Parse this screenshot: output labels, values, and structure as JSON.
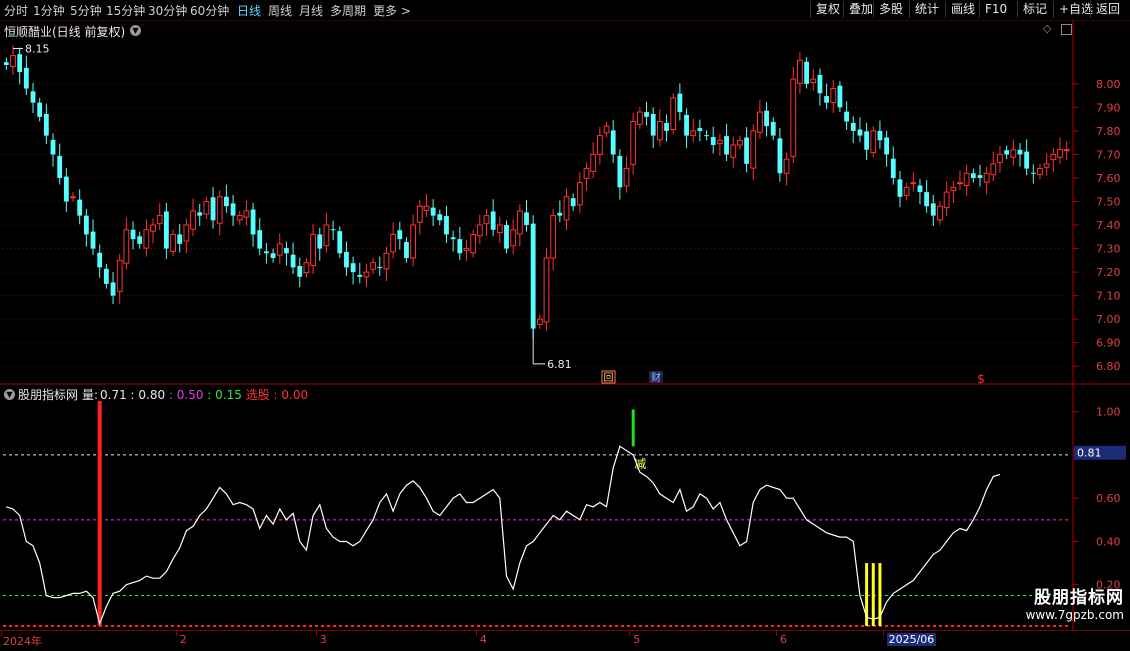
{
  "toolbar": {
    "left": [
      {
        "label": "分时",
        "active": false
      },
      {
        "label": "1分钟",
        "active": false
      },
      {
        "label": "5分钟",
        "active": false
      },
      {
        "label": "15分钟",
        "active": false
      },
      {
        "label": "30分钟",
        "active": false
      },
      {
        "label": "60分钟",
        "active": false
      },
      {
        "label": "日线",
        "active": true
      },
      {
        "label": "周线",
        "active": false
      },
      {
        "label": "月线",
        "active": false
      },
      {
        "label": "多周期",
        "active": false
      },
      {
        "label": "更多 >",
        "active": false
      }
    ],
    "right": [
      "复权",
      "叠加",
      "多股",
      "统计",
      "画线",
      "F10",
      "标记",
      "+自选",
      "返回"
    ]
  },
  "price_panel": {
    "title": "恒顺醋业(日线 前复权)",
    "high_label": "8.15",
    "low_label": "6.81",
    "markers": {
      "hui": "回",
      "cai": "财",
      "s": "$"
    }
  },
  "indicator_panel": {
    "name": "股朋指标网",
    "line_label": "量:",
    "values": [
      {
        "text": "0.71",
        "color": "#e8e8e8"
      },
      {
        "text": ": 0.80",
        "color": "#e8e8e8"
      },
      {
        "text": ": 0.50",
        "color": "#e040e0"
      },
      {
        "text": ": 0.15",
        "color": "#40e040"
      },
      {
        "text": "选股",
        "color": "#ff3030"
      },
      {
        "text": ": 0.00",
        "color": "#ff3030"
      }
    ],
    "current_value_badge": "0.81",
    "signal_text": "减"
  },
  "date_axis": {
    "labels": [
      "2024年",
      "2",
      "3",
      "4",
      "5",
      "6",
      "2025/06"
    ]
  },
  "logo": {
    "name": "股朋指标网",
    "url": "www.7gpzb.com"
  },
  "colors": {
    "up": "#ff3232",
    "down": "#54ffff",
    "grid": "#7a0000",
    "axis_text": "#e04040",
    "line": "#ffffff"
  },
  "chart_data": [
    {
      "type": "candlestick",
      "title": "恒顺醋业(日线 前复权)",
      "ylim": [
        6.75,
        8.25
      ],
      "y_ticks": [
        6.8,
        6.9,
        7.0,
        7.1,
        7.2,
        7.3,
        7.4,
        7.5,
        7.6,
        7.7,
        7.8,
        7.9,
        8.0
      ],
      "annotations": [
        {
          "label": "8.15",
          "kind": "high"
        },
        {
          "label": "6.81",
          "kind": "low"
        }
      ],
      "close": [
        8.08,
        8.12,
        8.05,
        7.98,
        7.92,
        7.86,
        7.78,
        7.7,
        7.6,
        7.5,
        7.52,
        7.44,
        7.36,
        7.3,
        7.22,
        7.15,
        7.1,
        7.25,
        7.38,
        7.34,
        7.32,
        7.38,
        7.4,
        7.44,
        7.3,
        7.36,
        7.32,
        7.4,
        7.46,
        7.44,
        7.5,
        7.42,
        7.52,
        7.48,
        7.44,
        7.44,
        7.46,
        7.36,
        7.3,
        7.28,
        7.26,
        7.32,
        7.28,
        7.22,
        7.18,
        7.24,
        7.36,
        7.3,
        7.4,
        7.38,
        7.28,
        7.22,
        7.2,
        7.18,
        7.2,
        7.24,
        7.22,
        7.28,
        7.36,
        7.34,
        7.26,
        7.4,
        7.48,
        7.48,
        7.44,
        7.42,
        7.36,
        7.34,
        7.28,
        7.3,
        7.36,
        7.4,
        7.44,
        7.38,
        7.4,
        7.3,
        7.38,
        7.46,
        7.4,
        6.96,
        7.0,
        7.26,
        7.44,
        7.44,
        7.52,
        7.48,
        7.58,
        7.64,
        7.7,
        7.78,
        7.82,
        7.7,
        7.56,
        7.64,
        7.84,
        7.88,
        7.86,
        7.78,
        7.84,
        7.8,
        7.94,
        7.88,
        7.78,
        7.8,
        7.8,
        7.78,
        7.74,
        7.76,
        7.7,
        7.74,
        7.76,
        7.66,
        7.8,
        7.88,
        7.82,
        7.78,
        7.62,
        7.68,
        8.02,
        8.1,
        8.0,
        8.02,
        7.96,
        7.92,
        7.98,
        7.9,
        7.84,
        7.8,
        7.78,
        7.72,
        7.8,
        7.76,
        7.7,
        7.6,
        7.52,
        7.56,
        7.58,
        7.54,
        7.48,
        7.44,
        7.48,
        7.54,
        7.56,
        7.58,
        7.62,
        7.6,
        7.6,
        7.62,
        7.66,
        7.7,
        7.7,
        7.72,
        7.7,
        7.64,
        7.62,
        7.64,
        7.66,
        7.7,
        7.72,
        7.72
      ]
    },
    {
      "type": "line",
      "name": "股朋指标网",
      "ylim": [
        0.0,
        1.1
      ],
      "y_ticks": [
        0.2,
        0.4,
        0.6,
        0.8,
        1.0
      ],
      "reference_lines": [
        {
          "value": 0.8,
          "color": "#e8e8e8"
        },
        {
          "value": 0.5,
          "color": "#e040e0"
        },
        {
          "value": 0.15,
          "color": "#40e040"
        }
      ],
      "values": [
        0.56,
        0.55,
        0.52,
        0.4,
        0.38,
        0.3,
        0.15,
        0.14,
        0.14,
        0.15,
        0.16,
        0.16,
        0.17,
        0.14,
        0.02,
        0.1,
        0.16,
        0.17,
        0.2,
        0.21,
        0.22,
        0.24,
        0.23,
        0.23,
        0.26,
        0.32,
        0.37,
        0.45,
        0.47,
        0.52,
        0.55,
        0.6,
        0.65,
        0.62,
        0.57,
        0.58,
        0.57,
        0.55,
        0.46,
        0.52,
        0.48,
        0.55,
        0.5,
        0.53,
        0.4,
        0.36,
        0.52,
        0.57,
        0.46,
        0.42,
        0.4,
        0.4,
        0.38,
        0.4,
        0.45,
        0.5,
        0.58,
        0.62,
        0.54,
        0.62,
        0.66,
        0.68,
        0.65,
        0.6,
        0.54,
        0.52,
        0.56,
        0.6,
        0.62,
        0.58,
        0.58,
        0.6,
        0.62,
        0.64,
        0.6,
        0.24,
        0.18,
        0.3,
        0.38,
        0.4,
        0.44,
        0.48,
        0.52,
        0.5,
        0.54,
        0.52,
        0.5,
        0.57,
        0.56,
        0.58,
        0.56,
        0.74,
        0.84,
        0.82,
        0.8,
        0.72,
        0.7,
        0.67,
        0.62,
        0.6,
        0.58,
        0.64,
        0.54,
        0.56,
        0.62,
        0.6,
        0.55,
        0.58,
        0.5,
        0.44,
        0.38,
        0.4,
        0.58,
        0.64,
        0.66,
        0.65,
        0.64,
        0.6,
        0.6,
        0.55,
        0.5,
        0.48,
        0.46,
        0.44,
        0.43,
        0.42,
        0.42,
        0.4,
        0.15,
        0.05,
        0.04,
        0.05,
        0.12,
        0.16,
        0.18,
        0.2,
        0.22,
        0.26,
        0.3,
        0.34,
        0.36,
        0.4,
        0.44,
        0.46,
        0.45,
        0.5,
        0.56,
        0.64,
        0.7,
        0.71
      ],
      "signals": [
        {
          "kind": "select",
          "color": "#ff2020",
          "index": 14
        },
        {
          "kind": "reduce",
          "color": "#20e020",
          "index": 94
        },
        {
          "kind": "buy",
          "color": "#ffff20",
          "index": 129
        },
        {
          "kind": "buy",
          "color": "#ffff20",
          "index": 130
        },
        {
          "kind": "buy",
          "color": "#ffff20",
          "index": 131
        }
      ]
    }
  ]
}
